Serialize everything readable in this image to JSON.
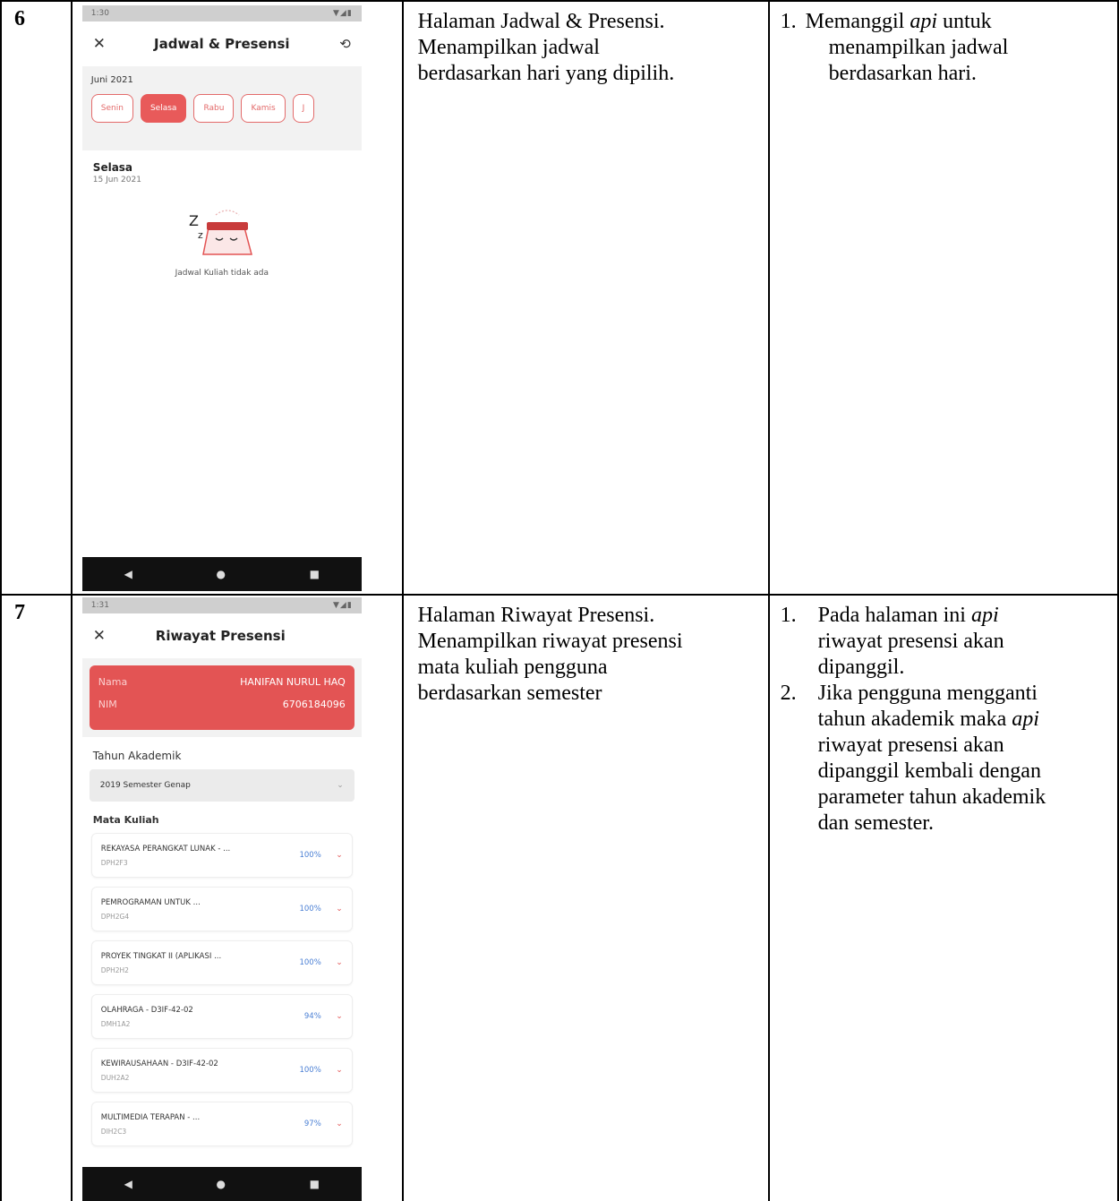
{
  "rows": [
    {
      "number": "6",
      "phone": {
        "status_time": "1:30",
        "status_icons": "▼◢▮",
        "title": "Jadwal & Presensi",
        "month": "Juni 2021",
        "days": [
          "Senin",
          "Selasa",
          "Rabu",
          "Kamis",
          "J"
        ],
        "active_day": "Selasa",
        "selected_day": "Selasa",
        "selected_date": "15 Jun 2021",
        "empty_message": "Jadwal Kuliah tidak ada"
      },
      "description": [
        "Halaman Jadwal & Presensi.",
        "Menampilkan jadwal",
        "berdasarkan hari yang dipilih."
      ],
      "notes": [
        {
          "num": "1.",
          "pre": "Memanggil ",
          "em": "api",
          "post": " untuk",
          "cont": [
            "menampilkan jadwal",
            "berdasarkan hari."
          ]
        }
      ]
    },
    {
      "number": "7",
      "phone": {
        "status_time": "1:31",
        "status_icons": "▼◢▮",
        "title": "Riwayat Presensi",
        "nama_label": "Nama",
        "nama_value": "HANIFAN NURUL HAQ",
        "nim_label": "NIM",
        "nim_value": "6706184096",
        "tahun_label": "Tahun Akademik",
        "tahun_value": "2019 Semester Genap",
        "mk_label": "Mata Kuliah",
        "courses": [
          {
            "name": "REKAYASA PERANGKAT LUNAK - ...",
            "code": "DPH2F3",
            "pct": "100%"
          },
          {
            "name": "PEMROGRAMAN UNTUK ...",
            "code": "DPH2G4",
            "pct": "100%"
          },
          {
            "name": "PROYEK TINGKAT II (APLIKASI ...",
            "code": "DPH2H2",
            "pct": "100%"
          },
          {
            "name": "OLAHRAGA - D3IF-42-02",
            "code": "DMH1A2",
            "pct": "94%"
          },
          {
            "name": "KEWIRAUSAHAAN - D3IF-42-02",
            "code": "DUH2A2",
            "pct": "100%"
          },
          {
            "name": "MULTIMEDIA TERAPAN - ...",
            "code": "DIH2C3",
            "pct": "97%"
          }
        ]
      },
      "description": [
        "Halaman Riwayat Presensi.",
        "Menampilkan riwayat presensi",
        "mata kuliah pengguna",
        "berdasarkan semester"
      ],
      "notes": [
        {
          "num": "1.",
          "pre": "Pada halaman ini ",
          "em": "api",
          "post": "",
          "cont": [
            "riwayat presensi akan",
            "dipanggil."
          ]
        },
        {
          "num": "2.",
          "pre": "Jika pengguna mengganti",
          "em": "",
          "post": "",
          "cont": [
            "tahun akademik maka |api|",
            "riwayat presensi akan",
            "dipanggil kembali dengan",
            "parameter tahun akademik",
            "dan semester."
          ]
        }
      ]
    }
  ]
}
